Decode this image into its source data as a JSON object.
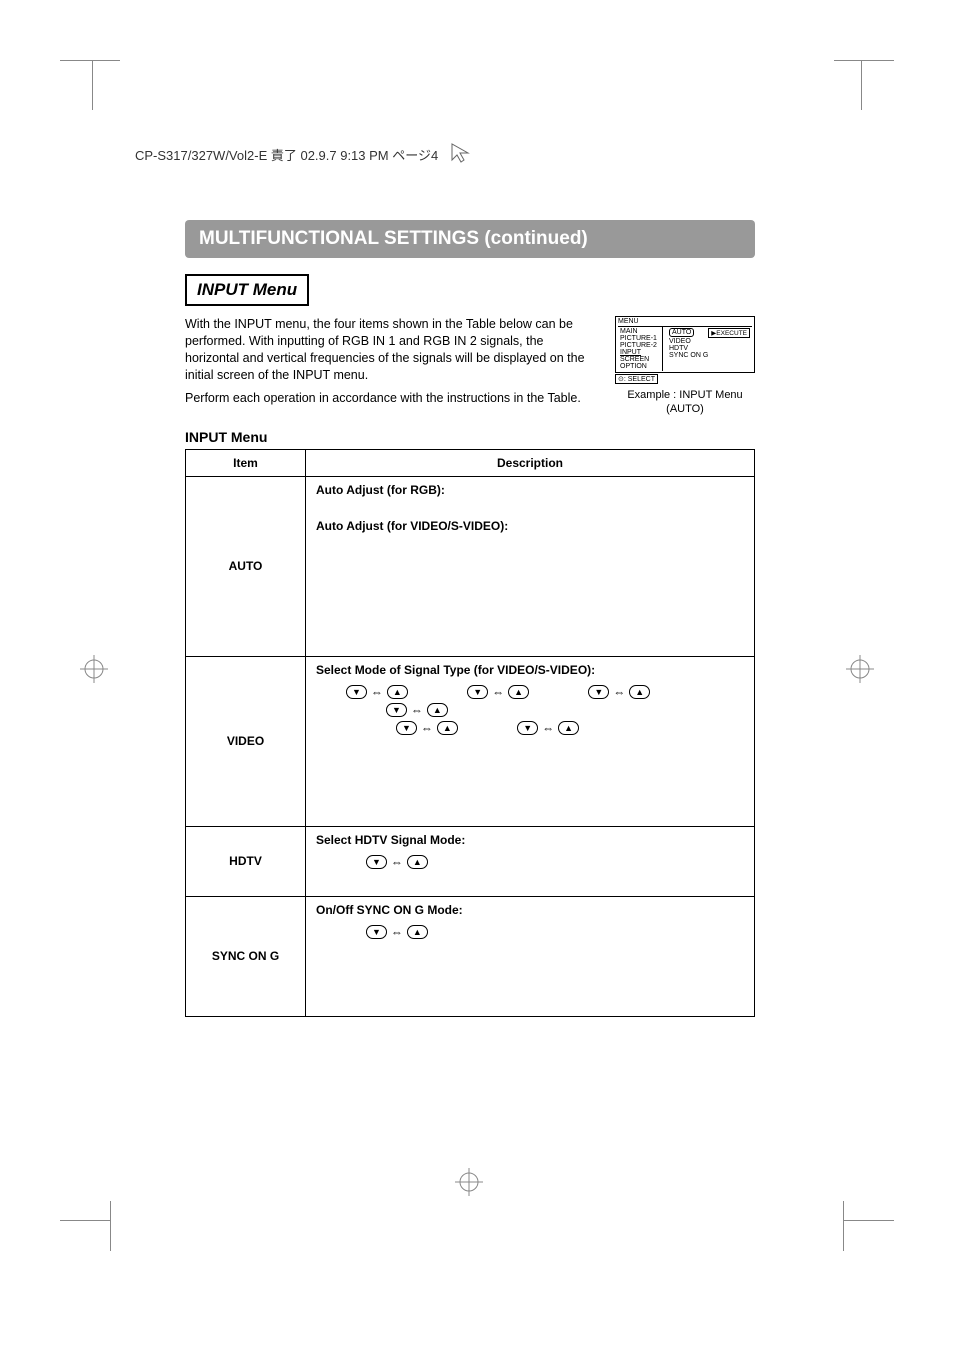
{
  "file_header": "CP-S317/327W/Vol2-E  責了  02.9.7  9:13 PM  ページ4",
  "title_banner": "MULTIFUNCTIONAL SETTINGS (continued)",
  "section_header": "INPUT Menu",
  "intro_para1": "With the INPUT menu, the four items shown in the Table below can be performed. With inputting of RGB IN 1 and RGB IN 2 signals, the horizontal and vertical frequencies of the signals will be displayed on the initial screen of the INPUT menu.",
  "intro_para2": "Perform each operation in accordance with the instructions in the Table.",
  "menu_preview": {
    "title": "MENU",
    "left_items": [
      "MAIN",
      "PICTURE-1",
      "PICTURE-2",
      "INPUT",
      "SCREEN",
      "OPTION"
    ],
    "selected_left": "INPUT",
    "right_items": [
      "AUTO",
      "VIDEO",
      "HDTV",
      "SYNC ON G"
    ],
    "selected_right": "AUTO",
    "exec_label": "EXECUTE",
    "select_label": ": SELECT",
    "caption_line1": "Example : INPUT Menu",
    "caption_line2": "(AUTO)"
  },
  "table_title": "INPUT Menu",
  "table_headers": {
    "item": "Item",
    "description": "Description"
  },
  "rows": [
    {
      "item": "AUTO",
      "subtitle1": "Auto Adjust (for RGB):",
      "subtitle2": "Auto Adjust (for VIDEO/S-VIDEO):"
    },
    {
      "item": "VIDEO",
      "subtitle": "Select Mode of Signal Type (for VIDEO/S-VIDEO):"
    },
    {
      "item": "HDTV",
      "subtitle": "Select HDTV Signal Mode:"
    },
    {
      "item": "SYNC ON G",
      "subtitle": "On/Off SYNC ON G Mode:"
    }
  ],
  "glyphs": {
    "down": "▼",
    "up": "▲",
    "lr_arrow": "⇔"
  }
}
